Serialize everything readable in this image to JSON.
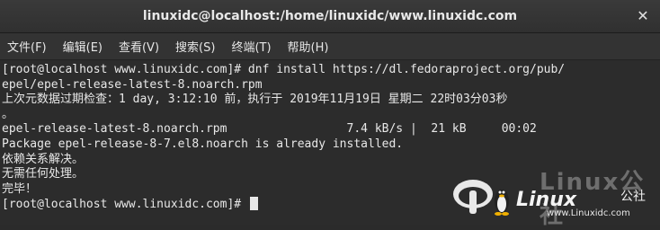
{
  "window": {
    "title": "linuxidc@localhost:/home/linuxidc/www.linuxidc.com",
    "close_glyph": "✕"
  },
  "menu": {
    "items": [
      {
        "label": "文件(F)"
      },
      {
        "label": "编辑(E)"
      },
      {
        "label": "查看(V)"
      },
      {
        "label": "搜索(S)"
      },
      {
        "label": "终端(T)"
      },
      {
        "label": "帮助(H)"
      }
    ]
  },
  "terminal": {
    "lines": [
      "[root@localhost www.linuxidc.com]# dnf install https://dl.fedoraproject.org/pub/",
      "epel/epel-release-latest-8.noarch.rpm",
      "上次元数据过期检查：1 day, 3:12:10 前，执行于 2019年11月19日 星期二 22时03分03秒",
      "。",
      "epel-release-latest-8.noarch.rpm                 7.4 kB/s |  21 kB     00:02",
      "Package epel-release-8-7.el8.noarch is already installed.",
      "依赖关系解决。",
      "无需任何处理。",
      "完毕！",
      "[root@localhost www.linuxidc.com]# "
    ]
  },
  "watermark": {
    "cn_text": "Linux公社",
    "logo_text": "Linux",
    "gongshe": "公社",
    "url": "www.Linuxidc.com"
  }
}
